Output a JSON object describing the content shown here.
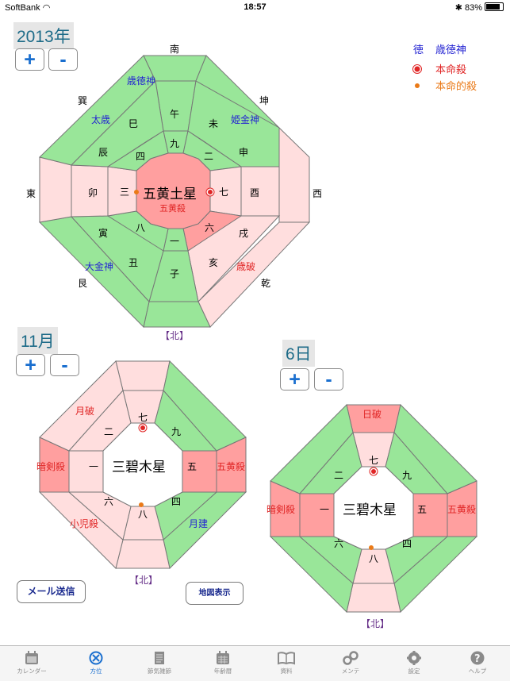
{
  "status": {
    "carrier": "SoftBank",
    "time": "18:57",
    "battery": "83%",
    "battery_level": 0.83
  },
  "colors": {
    "green": "#99e699",
    "lightpink": "#ffdede",
    "pink": "#ff9f9f",
    "blue": "#2323d2",
    "red": "#e02525",
    "orange": "#ea7a18",
    "purple": "#662f88",
    "accent": "#1a6fcf"
  },
  "year": {
    "label": "2013年",
    "plus": "+",
    "minus": "-",
    "center": "五黄土星",
    "center_sub": "五黄殺",
    "legend": {
      "toku": "徳",
      "saitokujin": "歳徳神",
      "honmeisatsu": "本命殺",
      "honmeitekisatsu": "本命的殺"
    },
    "dirs": [
      "南",
      "坤",
      "西",
      "乾",
      "北",
      "艮",
      "東",
      "巽"
    ],
    "north_label": "【北】",
    "gua": [
      "九",
      "二",
      "七",
      "戌",
      "一",
      "八",
      "三",
      "四"
    ],
    "gua_full": {
      "s": "九",
      "sw": "二",
      "w": "七",
      "nw": "六",
      "n": "一",
      "ne": "八",
      "e": "三",
      "se": "四"
    },
    "branches": {
      "wu": "午",
      "wei": "未",
      "shen": "申",
      "you": "酉",
      "xu": "戌",
      "hai": "亥",
      "zi": "子",
      "chou": "丑",
      "yin": "寅",
      "mao": "卯",
      "chen": "辰",
      "si": "巳"
    },
    "gods": {
      "saitokujin": "歳徳神",
      "himekonjin": "姫金神",
      "taisai": "太歳",
      "daikonjin": "大金神",
      "saiha": "歳破"
    }
  },
  "month": {
    "label": "11月",
    "plus": "+",
    "minus": "-",
    "center": "三碧木星",
    "north_label": "【北】",
    "gua": {
      "s": "七",
      "sw": "九",
      "w": "五",
      "nw": "四",
      "n": "八",
      "ne": "六",
      "e": "一",
      "se": "二"
    },
    "gods": {
      "getsuha": "月破",
      "ankensatsu": "暗剣殺",
      "gooosatsu": "五黄殺",
      "shojisatsu": "小児殺",
      "gekken": "月建"
    }
  },
  "day": {
    "label": "6日",
    "plus": "+",
    "minus": "-",
    "center": "三碧木星",
    "north_label": "【北】",
    "gua": {
      "s": "七",
      "sw": "九",
      "w": "五",
      "nw": "四",
      "n": "八",
      "ne": "六",
      "e": "一",
      "se": "二"
    },
    "gods": {
      "nippa": "日破",
      "ankensatsu": "暗剣殺",
      "gooosatsu": "五黄殺"
    }
  },
  "buttons": {
    "mail": "メール送信",
    "map": "地図表示"
  },
  "tabs": [
    "カレンダー",
    "方位",
    "節気雑節",
    "年齢暦",
    "資料",
    "メンテ",
    "設定",
    "ヘルプ"
  ]
}
